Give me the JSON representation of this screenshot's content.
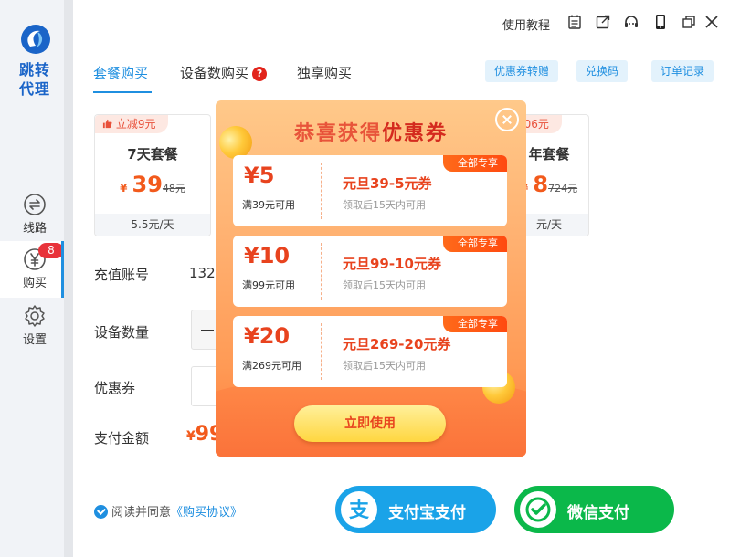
{
  "app": {
    "brand_line1": "跳转",
    "brand_line2": "代理",
    "accent_color": "#1f8fe0"
  },
  "topbar": {
    "tutorial_label": "使用教程",
    "icons": [
      "calendar-icon",
      "export-icon",
      "headset-icon",
      "phone-icon",
      "restore-icon",
      "close-icon"
    ]
  },
  "sidebar": {
    "items": [
      {
        "label": "线路",
        "icon": "route-icon"
      },
      {
        "label": "购买",
        "icon": "yen-icon",
        "badge": "8",
        "active": true
      },
      {
        "label": "设置",
        "icon": "gear-icon"
      }
    ]
  },
  "tabs": [
    {
      "label": "套餐购买",
      "active": true
    },
    {
      "label": "设备数购买",
      "help": "?"
    },
    {
      "label": "独享购买"
    }
  ],
  "actions": {
    "coupon_transfer": "优惠券转赠",
    "redeem_code": "兑换码",
    "order_history": "订单记录"
  },
  "plans": [
    {
      "tag": "立减9元",
      "title": "7天套餐",
      "currency": "¥",
      "price": "39",
      "old_price": "48元",
      "daily": "5.5元/天"
    },
    {
      "tag": "206元",
      "title": "年套餐",
      "currency": "¥",
      "price": "8",
      "old_price": "724元",
      "daily": "元/天"
    }
  ],
  "form": {
    "account_label": "充值账号",
    "account_value": "132",
    "device_count_label": "设备数量",
    "coupon_label": "优惠券",
    "pay_amount_label": "支付金额",
    "pay_currency": "¥",
    "pay_amount": "99"
  },
  "agreement": {
    "text": "阅读并同意",
    "link": "《购买协议》"
  },
  "payment": {
    "alipay_label": "支付宝支付",
    "wechat_label": "微信支付",
    "alipay_color": "#1aa3e8",
    "wechat_color": "#0bb84a"
  },
  "modal": {
    "title_prefix": "恭喜获得",
    "title_highlight": "优惠券",
    "use_button": "立即使用",
    "coupons": [
      {
        "tag": "全部专享",
        "amount": "¥5",
        "condition": "满39元可用",
        "name": "元旦39-5元券",
        "note": "领取后15天内可用"
      },
      {
        "tag": "全部专享",
        "amount": "¥10",
        "condition": "满99元可用",
        "name": "元旦99-10元券",
        "note": "领取后15天内可用"
      },
      {
        "tag": "全部专享",
        "amount": "¥20",
        "condition": "满269元可用",
        "name": "元旦269-20元券",
        "note": "领取后15天内可用"
      }
    ]
  }
}
